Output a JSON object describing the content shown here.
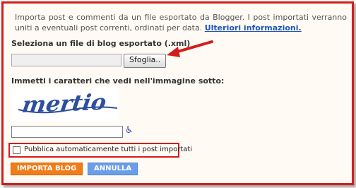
{
  "intro": {
    "text": "Importa post e commenti da un file esportato da Blogger. I post importati verranno uniti a eventuali post correnti, ordinati per data.",
    "link": "Ulteriori informazioni."
  },
  "file": {
    "label": "Seleziona un file di blog esportato (.xml)",
    "browse_button": "Sfoglia..",
    "value": ""
  },
  "captcha": {
    "label": "Immetti i caratteri che vedi nell'immagine sotto:",
    "image_text": "mertio",
    "input_value": "",
    "accessibility_icon": "wheelchair-icon"
  },
  "auto_publish": {
    "label": "Pubblica automaticamente tutti i post importati",
    "checked": false
  },
  "buttons": {
    "import": "IMPORTA BLOG",
    "cancel": "ANNULLA"
  },
  "colors": {
    "highlight_red": "#d21d1d",
    "link_blue": "#1f55b7",
    "import_orange": "#f07c1a",
    "cancel_blue": "#6c9ee8",
    "captcha_blue": "#2e4f9c"
  }
}
